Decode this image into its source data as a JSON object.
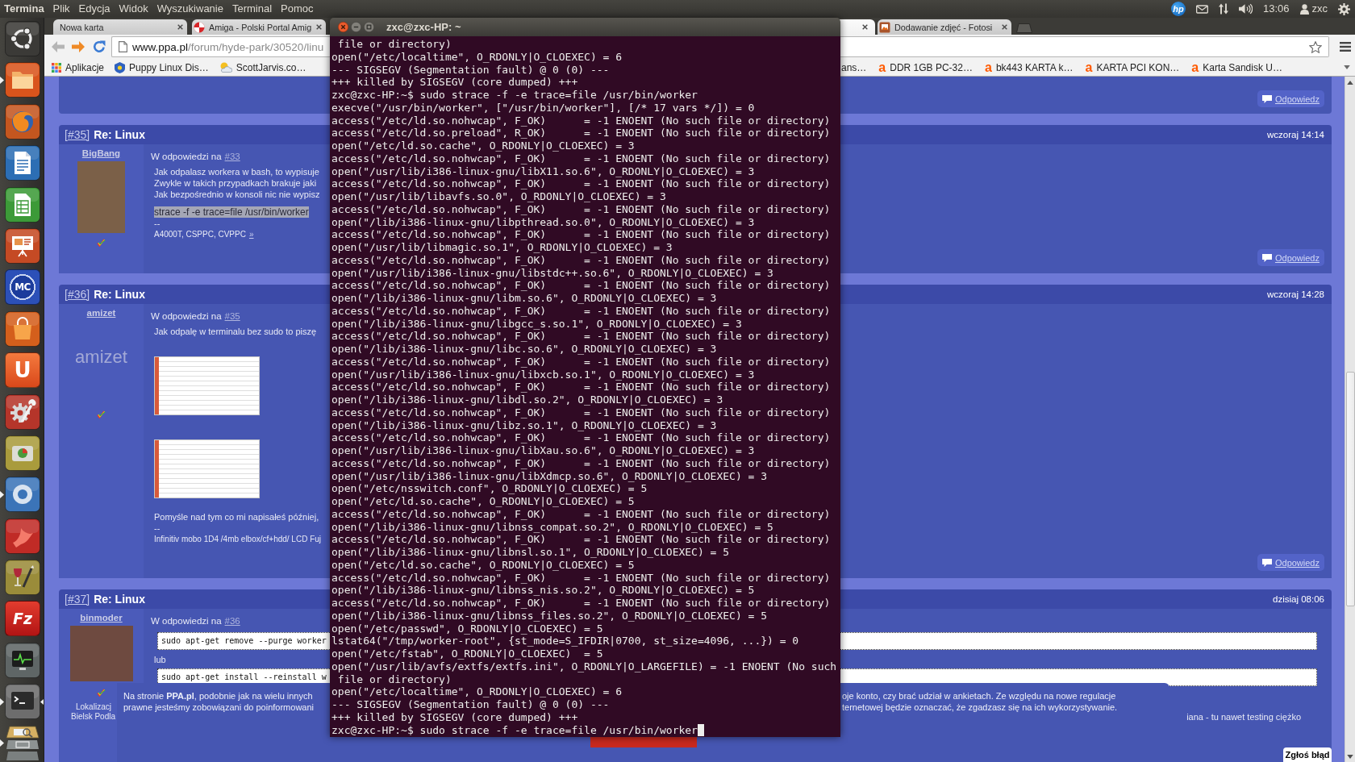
{
  "top_panel": {
    "app_name": "Termina",
    "menu": [
      "Plik",
      "Edycja",
      "Widok",
      "Wyszukiwanie",
      "Terminal",
      "Pomoc"
    ],
    "indicators": [
      {
        "kind": "vendor",
        "text": "hp"
      },
      {
        "kind": "mail"
      },
      {
        "kind": "network"
      },
      {
        "kind": "volume"
      },
      {
        "kind": "clock",
        "text": "13:06"
      },
      {
        "kind": "user",
        "text": "zxc"
      },
      {
        "kind": "session"
      }
    ]
  },
  "launcher": {
    "items": [
      {
        "kind": "dash",
        "running": false,
        "focused": false
      },
      {
        "kind": "folder",
        "running": true,
        "focused": false
      },
      {
        "kind": "globe",
        "running": false,
        "focused": false
      },
      {
        "kind": "document",
        "running": false,
        "focused": false
      },
      {
        "kind": "spreadsheet",
        "running": false,
        "focused": false
      },
      {
        "kind": "slides",
        "running": false,
        "focused": false
      },
      {
        "kind": "commander",
        "glyph": "MC",
        "running": false,
        "focused": false
      },
      {
        "kind": "bag",
        "running": false,
        "focused": false
      },
      {
        "kind": "letter",
        "glyph": "U",
        "running": false,
        "focused": false
      },
      {
        "kind": "tools",
        "running": false,
        "focused": false
      },
      {
        "kind": "disk",
        "running": false,
        "focused": false
      },
      {
        "kind": "ring",
        "running": true,
        "focused": false
      },
      {
        "kind": "bird",
        "running": false,
        "focused": false
      },
      {
        "kind": "brush",
        "running": false,
        "focused": false
      },
      {
        "kind": "fz",
        "glyph": "Fz",
        "running": false,
        "focused": false
      },
      {
        "kind": "monitor",
        "running": false,
        "focused": false
      },
      {
        "kind": "console",
        "running": true,
        "focused": true
      },
      {
        "kind": "stack",
        "running": true,
        "focused": false
      }
    ]
  },
  "browser": {
    "tabs_left": [
      {
        "kind": "plain",
        "title": "Nowa karta",
        "selected": false
      },
      {
        "kind": "ball",
        "title": "Amiga - Polski Portal Amig",
        "selected": false
      }
    ],
    "tabs_right": [
      {
        "kind": "plain",
        "selected": true
      },
      {
        "kind": "picture",
        "title": "Dodawanie zdjęć - Fotosi",
        "selected": false
      }
    ],
    "address": {
      "host": "www.ppa.pl",
      "path": "/forum/hyde-park/30520/linu"
    },
    "bookmarks_left": [
      {
        "kind": "apps",
        "title": "Aplikacje"
      },
      {
        "kind": "shield",
        "title": "Puppy Linux Dis…"
      },
      {
        "kind": "weather",
        "title": "ScottJarvis.co…"
      }
    ],
    "bookmarks_right": [
      {
        "kind": "plain",
        "title": "ans…"
      },
      {
        "kind": "logo",
        "glyph": "a",
        "title": "DDR 1GB PC-32…"
      },
      {
        "kind": "logo",
        "glyph": "a",
        "title": "bk443 KARTA k…"
      },
      {
        "kind": "logo",
        "glyph": "a",
        "title": "KARTA PCI KON…"
      },
      {
        "kind": "logo",
        "glyph": "a",
        "title": "Karta Sandisk U…"
      }
    ]
  },
  "forum": {
    "previous_post": {
      "reply": "Odpowiedz"
    },
    "posts": [
      {
        "number": "[#35]",
        "title": "Re: Linux",
        "date": "wczoraj 14:14",
        "author": {
          "name": "BigBang",
          "avatar": {
            "kind": "image"
          }
        },
        "reply_to": {
          "label": "W odpowiedzi na",
          "link": "#33"
        },
        "body": [
          {
            "kind": "text",
            "text": "Jak odpalasz workera w bash, to wypisuje"
          },
          {
            "kind": "text",
            "text": "Zwykle w takich przypadkach brakuje jaki"
          },
          {
            "kind": "text",
            "text": "Jak bezpośrednio w konsoli nic nie wypisz"
          },
          {
            "kind": "highlight",
            "text": "strace -f -e trace=file /usr/bin/worker"
          },
          {
            "kind": "separator",
            "text": "--"
          },
          {
            "kind": "signature",
            "text": "A4000T, CSPPC, CVPPC",
            "link": "»"
          }
        ],
        "reply": "Odpowiedz"
      },
      {
        "number": "[#36]",
        "title": "Re: Linux",
        "date": "wczoraj 14:28",
        "author": {
          "name": "amizet",
          "avatar": {
            "kind": "text",
            "text": "amizet"
          }
        },
        "reply_to": {
          "label": "W odpowiedzi na",
          "link": "#35"
        },
        "body": [
          {
            "kind": "text",
            "text": "Jak odpalę w terminalu bez sudo to piszę"
          },
          {
            "kind": "image"
          },
          {
            "kind": "image"
          },
          {
            "kind": "text",
            "text": "Pomyśle nad tym co mi napisałeś później,"
          },
          {
            "kind": "separator",
            "text": "--"
          },
          {
            "kind": "signature",
            "text": "Infinitiv mobo 1D4 /4mb elbox/cf+hdd/ LCD Fuj"
          }
        ],
        "reply": "Odpowiedz"
      },
      {
        "number": "[#37]",
        "title": "Re: Linux",
        "date": "dzisiaj 08:06",
        "author": {
          "name": "binmoder",
          "avatar": {
            "kind": "image"
          },
          "location": [
            "Lokalizacj",
            "Bielsk Podla"
          ]
        },
        "reply_to": {
          "label": "W odpowiedzi na",
          "link": "#36"
        },
        "body": [
          {
            "kind": "code",
            "text": "sudo apt-get remove --purge worker"
          },
          {
            "kind": "text",
            "text": "lub"
          },
          {
            "kind": "code",
            "text": "sudo apt-get install --reinstall w"
          },
          {
            "kind": "tail",
            "text": "iana - tu nawet testing ciężko"
          }
        ]
      }
    ]
  },
  "cookie_banner": {
    "left_lines": [
      "Na stronie **PPA.pl**, podobnie jak na wielu innych",
      "prawne jesteśmy zobowiązani do poinformowani"
    ],
    "right_lines": [
      "oje konto, czy brać udział w ankietach. Ze względu na nowe regulacje",
      "ternetowej będzie oznaczać, że zgadzasz się na ich wykorzystywanie."
    ]
  },
  "report_button": "Zgłoś błąd",
  "terminal": {
    "title": "zxc@zxc-HP: ~",
    "lines": [
      " file or directory)",
      "open(\"/etc/localtime\", O_RDONLY|O_CLOEXEC) = 6",
      "--- SIGSEGV (Segmentation fault) @ 0 (0) ---",
      "+++ killed by SIGSEGV (core dumped) +++",
      "zxc@zxc-HP:~$ sudo strace -f -e trace=file /usr/bin/worker",
      "execve(\"/usr/bin/worker\", [\"/usr/bin/worker\"], [/* 17 vars */]) = 0",
      "access(\"/etc/ld.so.nohwcap\", F_OK)      = -1 ENOENT (No such file or directory)",
      "access(\"/etc/ld.so.preload\", R_OK)      = -1 ENOENT (No such file or directory)",
      "open(\"/etc/ld.so.cache\", O_RDONLY|O_CLOEXEC) = 3",
      "access(\"/etc/ld.so.nohwcap\", F_OK)      = -1 ENOENT (No such file or directory)",
      "open(\"/usr/lib/i386-linux-gnu/libX11.so.6\", O_RDONLY|O_CLOEXEC) = 3",
      "access(\"/etc/ld.so.nohwcap\", F_OK)      = -1 ENOENT (No such file or directory)",
      "open(\"/usr/lib/libavfs.so.0\", O_RDONLY|O_CLOEXEC) = 3",
      "access(\"/etc/ld.so.nohwcap\", F_OK)      = -1 ENOENT (No such file or directory)",
      "open(\"/lib/i386-linux-gnu/libpthread.so.0\", O_RDONLY|O_CLOEXEC) = 3",
      "access(\"/etc/ld.so.nohwcap\", F_OK)      = -1 ENOENT (No such file or directory)",
      "open(\"/usr/lib/libmagic.so.1\", O_RDONLY|O_CLOEXEC) = 3",
      "access(\"/etc/ld.so.nohwcap\", F_OK)      = -1 ENOENT (No such file or directory)",
      "open(\"/usr/lib/i386-linux-gnu/libstdc++.so.6\", O_RDONLY|O_CLOEXEC) = 3",
      "access(\"/etc/ld.so.nohwcap\", F_OK)      = -1 ENOENT (No such file or directory)",
      "open(\"/lib/i386-linux-gnu/libm.so.6\", O_RDONLY|O_CLOEXEC) = 3",
      "access(\"/etc/ld.so.nohwcap\", F_OK)      = -1 ENOENT (No such file or directory)",
      "open(\"/lib/i386-linux-gnu/libgcc_s.so.1\", O_RDONLY|O_CLOEXEC) = 3",
      "access(\"/etc/ld.so.nohwcap\", F_OK)      = -1 ENOENT (No such file or directory)",
      "open(\"/lib/i386-linux-gnu/libc.so.6\", O_RDONLY|O_CLOEXEC) = 3",
      "access(\"/etc/ld.so.nohwcap\", F_OK)      = -1 ENOENT (No such file or directory)",
      "open(\"/usr/lib/i386-linux-gnu/libxcb.so.1\", O_RDONLY|O_CLOEXEC) = 3",
      "access(\"/etc/ld.so.nohwcap\", F_OK)      = -1 ENOENT (No such file or directory)",
      "open(\"/lib/i386-linux-gnu/libdl.so.2\", O_RDONLY|O_CLOEXEC) = 3",
      "access(\"/etc/ld.so.nohwcap\", F_OK)      = -1 ENOENT (No such file or directory)",
      "open(\"/lib/i386-linux-gnu/libz.so.1\", O_RDONLY|O_CLOEXEC) = 3",
      "access(\"/etc/ld.so.nohwcap\", F_OK)      = -1 ENOENT (No such file or directory)",
      "open(\"/usr/lib/i386-linux-gnu/libXau.so.6\", O_RDONLY|O_CLOEXEC) = 3",
      "access(\"/etc/ld.so.nohwcap\", F_OK)      = -1 ENOENT (No such file or directory)",
      "open(\"/usr/lib/i386-linux-gnu/libXdmcp.so.6\", O_RDONLY|O_CLOEXEC) = 3",
      "open(\"/etc/nsswitch.conf\", O_RDONLY|O_CLOEXEC) = 5",
      "open(\"/etc/ld.so.cache\", O_RDONLY|O_CLOEXEC) = 5",
      "access(\"/etc/ld.so.nohwcap\", F_OK)      = -1 ENOENT (No such file or directory)",
      "open(\"/lib/i386-linux-gnu/libnss_compat.so.2\", O_RDONLY|O_CLOEXEC) = 5",
      "access(\"/etc/ld.so.nohwcap\", F_OK)      = -1 ENOENT (No such file or directory)",
      "open(\"/lib/i386-linux-gnu/libnsl.so.1\", O_RDONLY|O_CLOEXEC) = 5",
      "open(\"/etc/ld.so.cache\", O_RDONLY|O_CLOEXEC) = 5",
      "access(\"/etc/ld.so.nohwcap\", F_OK)      = -1 ENOENT (No such file or directory)",
      "open(\"/lib/i386-linux-gnu/libnss_nis.so.2\", O_RDONLY|O_CLOEXEC) = 5",
      "access(\"/etc/ld.so.nohwcap\", F_OK)      = -1 ENOENT (No such file or directory)",
      "open(\"/lib/i386-linux-gnu/libnss_files.so.2\", O_RDONLY|O_CLOEXEC) = 5",
      "open(\"/etc/passwd\", O_RDONLY|O_CLOEXEC) = 5",
      "lstat64(\"/tmp/worker-root\", {st_mode=S_IFDIR|0700, st_size=4096, ...}) = 0",
      "open(\"/etc/fstab\", O_RDONLY|O_CLOEXEC)  = 5",
      "open(\"/usr/lib/avfs/extfs/extfs.ini\", O_RDONLY|O_LARGEFILE) = -1 ENOENT (No such",
      " file or directory)",
      "open(\"/etc/localtime\", O_RDONLY|O_CLOEXEC) = 6",
      "--- SIGSEGV (Segmentation fault) @ 0 (0) ---",
      "+++ killed by SIGSEGV (core dumped) +++",
      "zxc@zxc-HP:~$ sudo strace -f -e trace=file /usr/bin/worker"
    ]
  }
}
